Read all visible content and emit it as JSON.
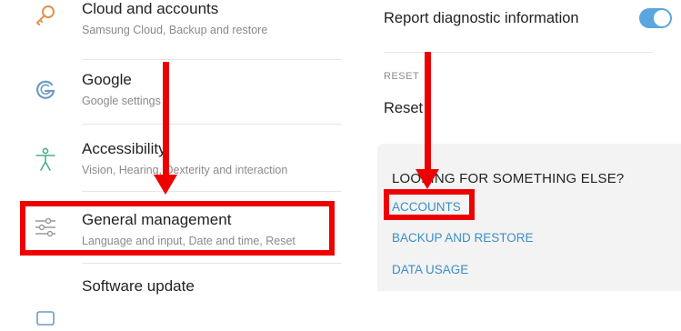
{
  "left_list": {
    "items": [
      {
        "title": "Cloud and accounts",
        "subtitle": "Samsung Cloud, Backup and restore",
        "icon": "key-icon"
      },
      {
        "title": "Google",
        "subtitle": "Google settings",
        "icon": "google-g-icon"
      },
      {
        "title": "Accessibility",
        "subtitle": "Vision, Hearing, Dexterity and interaction",
        "icon": "accessibility-icon"
      },
      {
        "title": "General management",
        "subtitle": "Language and input, Date and time, Reset",
        "icon": "sliders-icon"
      },
      {
        "title": "Software update",
        "subtitle": "",
        "icon": "software-update-icon"
      }
    ]
  },
  "right_panel": {
    "diagnostic": {
      "label": "Report diagnostic information",
      "enabled": true
    },
    "reset_section": {
      "header": "RESET",
      "reset_label": "Reset"
    },
    "suggestions": {
      "title": "LOOKING FOR SOMETHING ELSE?",
      "links": [
        "ACCOUNTS",
        "BACKUP AND RESTORE",
        "DATA USAGE"
      ]
    }
  },
  "colors": {
    "accent": "#3a8fc6",
    "toggle": "#5aa7e0",
    "annotation_red": "#ee0000",
    "icon": "#6f9ac8",
    "icon_orange": "#e3924b"
  }
}
